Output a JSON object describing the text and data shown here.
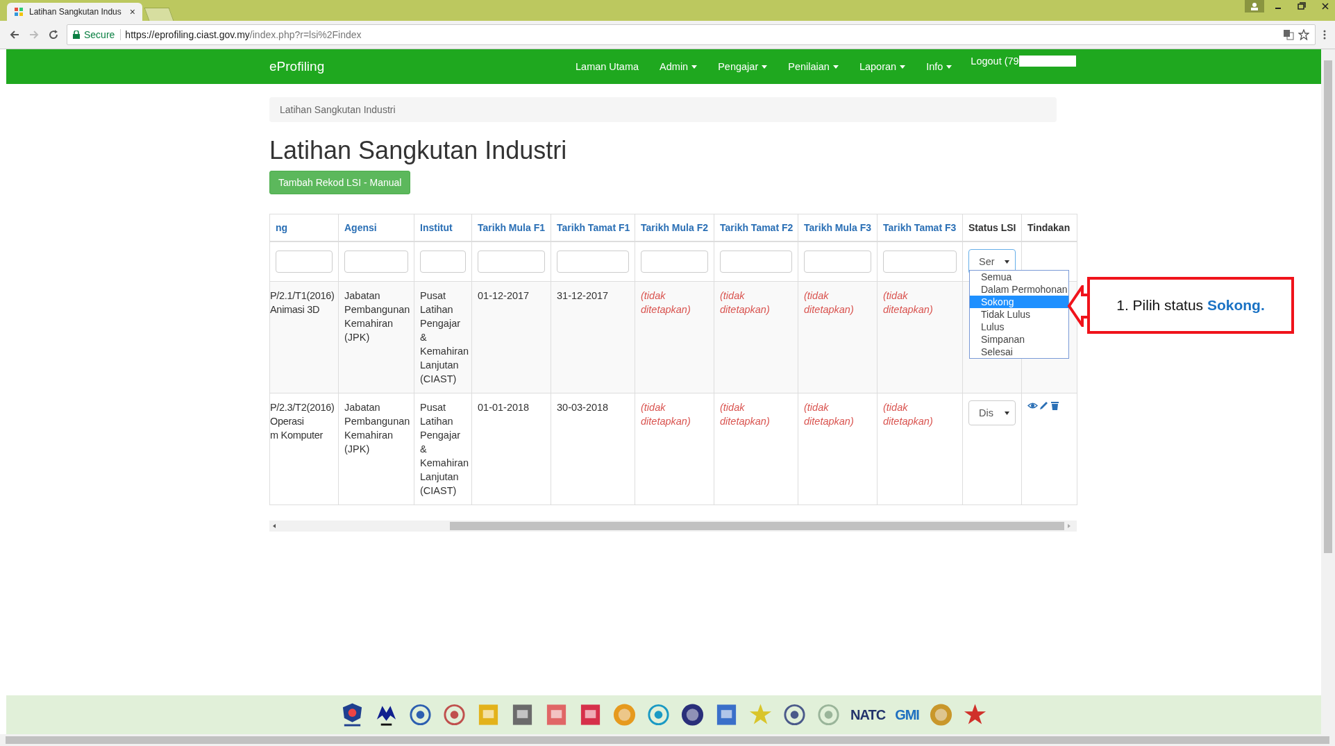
{
  "browser": {
    "tab_title": "Latihan Sangkutan Indus",
    "tab_close": "×",
    "secure_label": "Secure",
    "url_host": "https://eprofiling.ciast.gov.my",
    "url_path": "/index.php?r=lsi%2Findex"
  },
  "navbar": {
    "brand": "eProfiling",
    "items": [
      {
        "label": "Laman Utama",
        "has_menu": false
      },
      {
        "label": "Admin",
        "has_menu": true
      },
      {
        "label": "Pengajar",
        "has_menu": true
      },
      {
        "label": "Penilaian",
        "has_menu": true
      },
      {
        "label": "Laporan",
        "has_menu": true
      },
      {
        "label": "Info",
        "has_menu": true
      }
    ],
    "logout": "Logout (79"
  },
  "breadcrumb": "Latihan Sangkutan Industri",
  "page_title": "Latihan Sangkutan Industri",
  "add_button": "Tambah Rekod LSI - Manual",
  "table": {
    "columns": [
      {
        "label": "ng",
        "kind": "link"
      },
      {
        "label": "Agensi",
        "kind": "link"
      },
      {
        "label": "Institut",
        "kind": "link"
      },
      {
        "label": "Tarikh Mula F1",
        "kind": "link"
      },
      {
        "label": "Tarikh Tamat F1",
        "kind": "link"
      },
      {
        "label": "Tarikh Mula F2",
        "kind": "link"
      },
      {
        "label": "Tarikh Tamat F2",
        "kind": "link"
      },
      {
        "label": "Tarikh Mula F3",
        "kind": "link"
      },
      {
        "label": "Tarikh Tamat F3",
        "kind": "link"
      },
      {
        "label": "Status LSI",
        "kind": "plain"
      },
      {
        "label": "Tindakan",
        "kind": "plain"
      }
    ],
    "filter_select": "Ser",
    "rows": [
      {
        "cells": [
          [
            "P/2.1/T1(2016)",
            "Animasi 3D"
          ],
          [
            "Jabatan",
            "Pembangunan",
            "Kemahiran",
            "(JPK)"
          ],
          [
            "Pusat",
            "Latihan",
            "Pengajar",
            "&",
            "Kemahiran",
            "Lanjutan",
            "(CIAST)"
          ],
          [
            "01-12-2017"
          ],
          [
            "31-12-2017"
          ],
          [
            "(tidak",
            "ditetapkan)"
          ],
          [
            "(tidak",
            "ditetapkan)"
          ],
          [
            "(tidak",
            "ditetapkan)"
          ],
          [
            "(tidak",
            "ditetapkan)"
          ]
        ],
        "missing": [
          false,
          false,
          false,
          false,
          false,
          true,
          true,
          true,
          true
        ],
        "actions": false
      },
      {
        "cells": [
          [
            "P/2.3/T2(2016)",
            "Operasi",
            "m Komputer"
          ],
          [
            "Jabatan",
            "Pembangunan",
            "Kemahiran",
            "(JPK)"
          ],
          [
            "Pusat",
            "Latihan",
            "Pengajar",
            "&",
            "Kemahiran",
            "Lanjutan",
            "(CIAST)"
          ],
          [
            "01-01-2018"
          ],
          [
            "30-03-2018"
          ],
          [
            "(tidak",
            "ditetapkan)"
          ],
          [
            "(tidak",
            "ditetapkan)"
          ],
          [
            "(tidak",
            "ditetapkan)"
          ],
          [
            "(tidak",
            "ditetapkan)"
          ]
        ],
        "missing": [
          false,
          false,
          false,
          false,
          false,
          true,
          true,
          true,
          true
        ],
        "status_select": "Dis",
        "actions": true
      }
    ]
  },
  "dropdown": {
    "options": [
      {
        "label": "Semua",
        "selected": false
      },
      {
        "label": "Dalam Permohonan",
        "selected": false
      },
      {
        "label": "Sokong",
        "selected": true
      },
      {
        "label": "Tidak Lulus",
        "selected": false
      },
      {
        "label": "Lulus",
        "selected": false
      },
      {
        "label": "Simpanan",
        "selected": false
      },
      {
        "label": "Selesai",
        "selected": false
      }
    ]
  },
  "callout": "1. Pilih status **Sokong.**",
  "footer": {
    "logos": [
      {
        "kind": "shield",
        "color": "#1f3f8f"
      },
      {
        "kind": "mark",
        "color": "#10208f"
      },
      {
        "kind": "ring",
        "color": "#2d5fb0"
      },
      {
        "kind": "ring",
        "color": "#c0504d"
      },
      {
        "kind": "rect",
        "color": "#e3b21b"
      },
      {
        "kind": "rect",
        "color": "#6b6b6b"
      },
      {
        "kind": "rect",
        "color": "#e06666"
      },
      {
        "kind": "rect",
        "color": "#d6304a"
      },
      {
        "kind": "disc",
        "color": "#e69a1e"
      },
      {
        "kind": "ring",
        "color": "#1a9ac4"
      },
      {
        "kind": "disc",
        "color": "#2a2f7a"
      },
      {
        "kind": "rect",
        "color": "#3a6fc9"
      },
      {
        "kind": "star",
        "color": "#d9c52a"
      },
      {
        "kind": "ring",
        "color": "#4b5a8a"
      },
      {
        "kind": "ring",
        "color": "#9ab59a"
      },
      {
        "kind": "text",
        "color": "#22336b",
        "text": "NATC"
      },
      {
        "kind": "text",
        "color": "#1e6fc0",
        "text": "GMI"
      },
      {
        "kind": "disc",
        "color": "#c9972b"
      },
      {
        "kind": "star",
        "color": "#d0302a"
      }
    ]
  }
}
